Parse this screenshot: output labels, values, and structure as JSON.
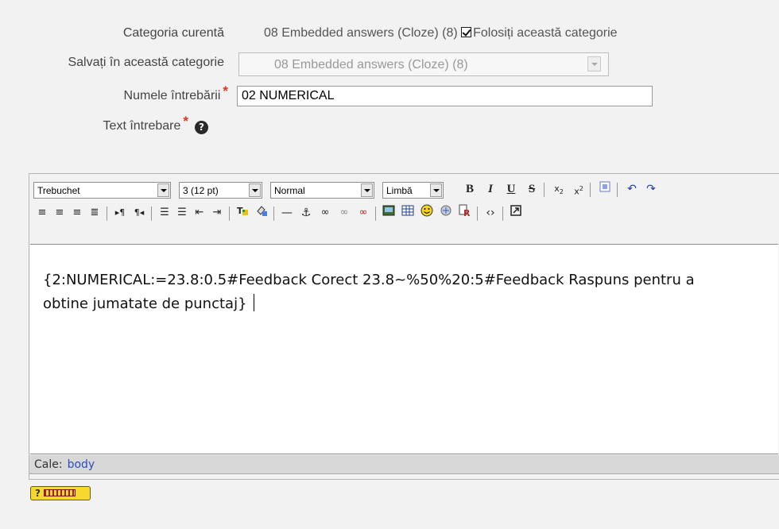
{
  "form": {
    "current_category_label": "Categoria curentă",
    "current_category_value": "08 Embedded answers (Cloze) (8)",
    "use_category_label": "Folosiți această categorie",
    "use_category_checked": true,
    "save_category_label": "Salvați în această categorie",
    "save_category_value": "08 Embedded answers (Cloze) (8)",
    "question_name_label": "Numele întrebării",
    "question_name_value": "02 NUMERICAL",
    "question_text_label": "Text întrebare",
    "required_mark": "*",
    "help_icon_glyph": "?"
  },
  "toolbar": {
    "font_family": "Trebuchet",
    "font_size": "3 (12 pt)",
    "format": "Normal",
    "language": "Limbă",
    "bold": "B",
    "italic": "I",
    "underline": "U",
    "strikethrough": "S"
  },
  "editor": {
    "content_text": "{2:NUMERICAL:=23.8:0.5#Feedback Corect 23.8~%50%20:5#Feedback Raspuns pentru a obtine jumatate de punctaj}",
    "path_label": "Cale:",
    "path_value": "body",
    "help_button_label": "?"
  },
  "colors": {
    "required": "#e8331b",
    "link": "#2a4ec0",
    "keyboard_help_bg": "#f6d92c"
  }
}
